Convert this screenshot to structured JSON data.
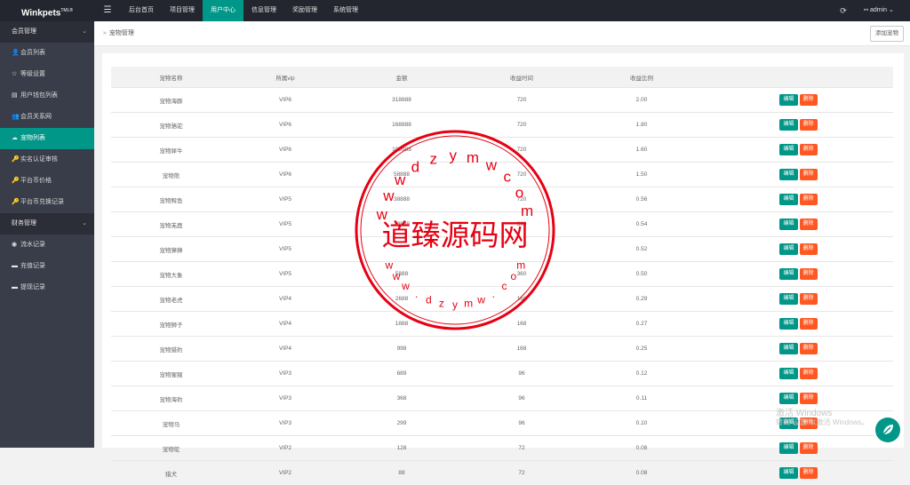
{
  "app": {
    "logo": "Winkpets",
    "logo_sup": "TML®"
  },
  "header": {
    "menu_icon": "☰",
    "nav": [
      {
        "label": "后台首页",
        "active": false
      },
      {
        "label": "项目管理",
        "active": false
      },
      {
        "label": "用户中心",
        "active": true
      },
      {
        "label": "信息管理",
        "active": false
      },
      {
        "label": "奖励管理",
        "active": false
      },
      {
        "label": "系统管理",
        "active": false
      }
    ],
    "refresh_icon": "⟳",
    "user": "admin",
    "user_icon": "👤"
  },
  "sidebar": {
    "groups": [
      {
        "title": "会员管理",
        "items": [
          {
            "label": "会员列表",
            "icon": "👤",
            "active": false
          },
          {
            "label": "等级设置",
            "icon": "☆",
            "active": false
          },
          {
            "label": "用户钱包列表",
            "icon": "▤",
            "active": false
          },
          {
            "label": "会员关系网",
            "icon": "👥",
            "active": false
          },
          {
            "label": "宠物列表",
            "icon": "☁",
            "active": true
          },
          {
            "label": "实名认证审核",
            "icon": "🔑",
            "active": false
          },
          {
            "label": "平台币价格",
            "icon": "🔑",
            "active": false
          },
          {
            "label": "平台币兑换记录",
            "icon": "🔑",
            "active": false
          }
        ]
      },
      {
        "title": "财务管理",
        "items": [
          {
            "label": "流水记录",
            "icon": "◉",
            "active": false
          },
          {
            "label": "充值记录",
            "icon": "▬",
            "active": false
          },
          {
            "label": "提现记录",
            "icon": "▬",
            "active": false
          }
        ]
      }
    ]
  },
  "breadcrumb": {
    "sep": "»",
    "current": "宠物管理"
  },
  "add_button": "添加宠物",
  "table": {
    "headers": [
      "宠物名称",
      "所属vip",
      "金额",
      "收益时间",
      "收益比例",
      ""
    ],
    "edit_label": "编辑",
    "delete_label": "删除",
    "rows": [
      [
        "宠物海豚",
        "VIP6",
        "318888",
        "720",
        "2.00"
      ],
      [
        "宠物骆驼",
        "VIP6",
        "168888",
        "720",
        "1.80"
      ],
      [
        "宠物犀牛",
        "VIP6",
        "109988",
        "720",
        "1.60"
      ],
      [
        "宠物熊",
        "VIP6",
        "58888",
        "720",
        "1.50"
      ],
      [
        "宠物鳄鱼",
        "VIP5",
        "38888",
        "720",
        "0.56"
      ],
      [
        "宠物羌鹿",
        "VIP5",
        "18888",
        "360",
        "0.54"
      ],
      [
        "宠物獐獐",
        "VIP5",
        "",
        "",
        "0.52"
      ],
      [
        "宠物大象",
        "VIP5",
        "5888",
        "360",
        "0.50"
      ],
      [
        "宠物老虎",
        "VIP4",
        "2688",
        "168",
        "0.29"
      ],
      [
        "宠物狮子",
        "VIP4",
        "1888",
        "168",
        "0.27"
      ],
      [
        "宠物猎豹",
        "VIP4",
        "998",
        "168",
        "0.25"
      ],
      [
        "宠物猩猩",
        "VIP3",
        "689",
        "96",
        "0.12"
      ],
      [
        "宠物海豹",
        "VIP3",
        "368",
        "96",
        "0.11"
      ],
      [
        "宠物马",
        "VIP3",
        "299",
        "96",
        "0.10"
      ],
      [
        "宠物鸵",
        "VIP2",
        "128",
        "72",
        "0.08"
      ],
      [
        "猎犬",
        "VIP2",
        "88",
        "72",
        "0.08"
      ]
    ]
  },
  "watermark": {
    "main": "道臻源码网",
    "top_arc": "wwwdzymwcom",
    "bottom_arc": "www.dzymw.com",
    "color": "#e60012"
  },
  "windows_activation": {
    "line1": "激活 Windows",
    "line2": "转到\"设置\"以激活 Windows。"
  }
}
